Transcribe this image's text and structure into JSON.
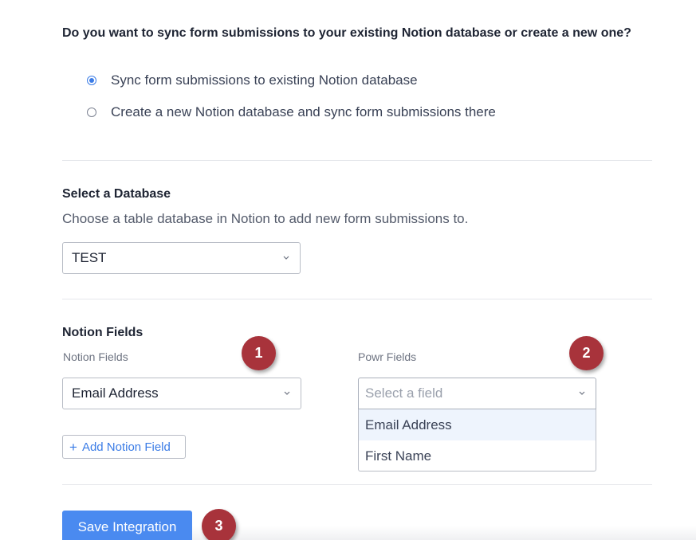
{
  "sync": {
    "question": "Do you want to sync form submissions to your existing Notion database or create a new one?",
    "options": [
      {
        "label": "Sync form submissions to existing Notion database",
        "checked": true
      },
      {
        "label": "Create a new Notion database and sync form submissions there",
        "checked": false
      }
    ]
  },
  "database": {
    "title": "Select a Database",
    "description": "Choose a table database in Notion to add new form submissions to.",
    "selected": "TEST"
  },
  "fields": {
    "title": "Notion Fields",
    "notion_label": "Notion Fields",
    "notion_selected": "Email Address",
    "powr_label": "Powr Fields",
    "powr_placeholder": "Select a field",
    "powr_options": [
      "Email Address",
      "First Name"
    ],
    "add_label": "Add Notion Field",
    "add_icon": "+"
  },
  "actions": {
    "save_label": "Save Integration"
  },
  "badges": [
    "1",
    "2",
    "3"
  ],
  "colors": {
    "accent": "#4a8af0",
    "badge": "#a8333b"
  }
}
